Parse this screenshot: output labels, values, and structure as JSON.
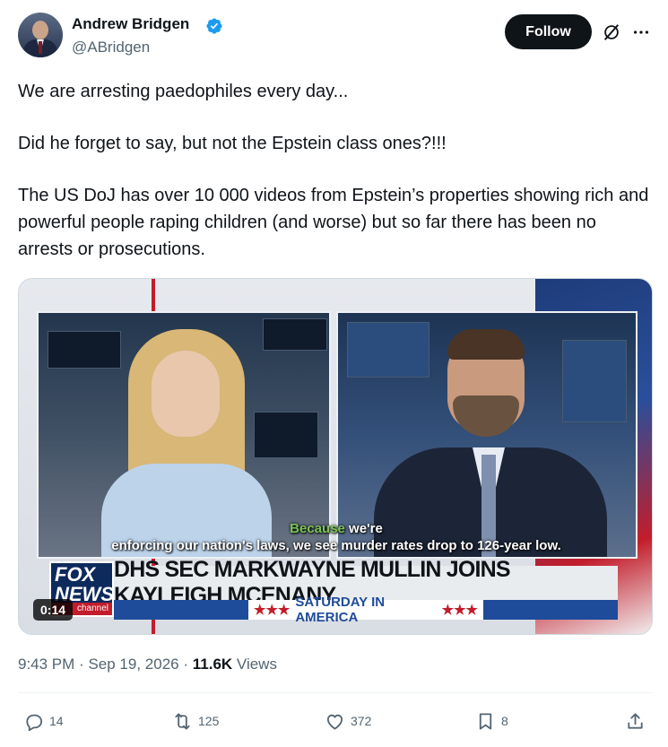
{
  "author": {
    "name": "Andrew Bridgen",
    "handle": "@ABridgen",
    "verified_icon": "verified-badge-icon"
  },
  "header": {
    "follow_label": "Follow"
  },
  "tweet": {
    "paragraphs": [
      "We are arresting paedophiles every day...",
      "Did he forget to say, but not the Epstein class ones?!!!",
      "The US DoJ has over 10 000 videos from Epstein’s properties showing rich and powerful people raping children (and worse) but so far there has been no arrests or prosecutions."
    ]
  },
  "video": {
    "duration": "0:14",
    "caption_highlight": "Because",
    "caption_line1_rest": " we're",
    "caption_line2": "enforcing our nation's laws, we see murder rates drop to 126-year low.",
    "logo_text": "FOX NEWS",
    "logo_channel": "channel",
    "headline": "DHS SEC MARKWAYNE MULLIN JOINS KAYLEIGH MCENANY",
    "show_name": "SATURDAY IN AMERICA",
    "show_stars": "★★★"
  },
  "meta": {
    "time": "9:43 PM",
    "separator": "·",
    "date": "Sep 19, 2026",
    "views_count": "11.6K",
    "views_label": "Views"
  },
  "actions": {
    "replies": "14",
    "reposts": "125",
    "likes": "372",
    "bookmarks": "8"
  },
  "colors": {
    "text": "#0f1419",
    "secondary": "#536471",
    "verified": "#1d9bf0",
    "follow_bg": "#0f1419"
  }
}
